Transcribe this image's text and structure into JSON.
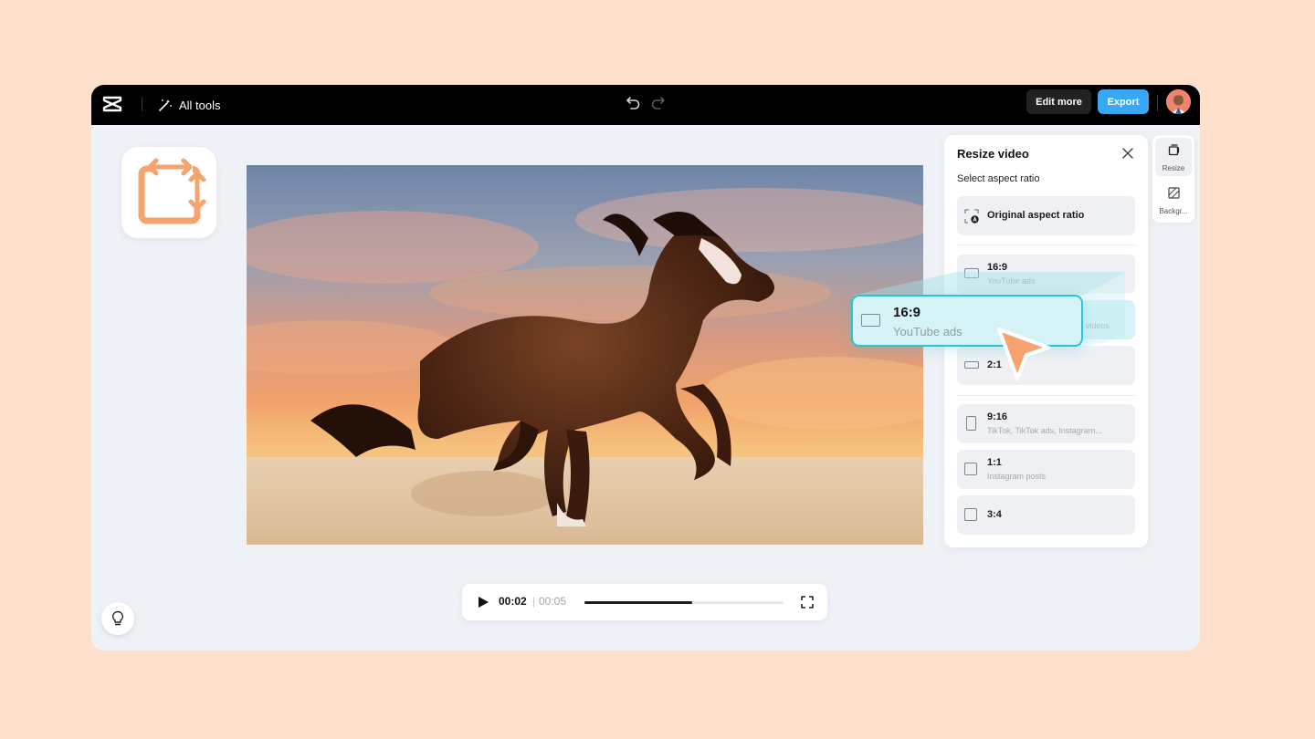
{
  "toolbar": {
    "all_tools_label": "All tools",
    "edit_more_label": "Edit more",
    "export_label": "Export"
  },
  "player": {
    "current_time": "00:02",
    "separator": "|",
    "total_time": "00:05",
    "progress_fraction": 0.54
  },
  "resize_panel": {
    "title": "Resize video",
    "subtitle": "Select aspect ratio",
    "original_label": "Original aspect ratio",
    "options": [
      {
        "label": "16:9",
        "desc": "YouTube ads"
      },
      {
        "label": "",
        "desc": "videos"
      },
      {
        "label": "2:1",
        "desc": ""
      },
      {
        "label": "9:16",
        "desc": "TikTok, TikTok ads, Instagram..."
      },
      {
        "label": "1:1",
        "desc": "Instagram posts"
      },
      {
        "label": "3:4",
        "desc": ""
      }
    ]
  },
  "side_tabs": [
    {
      "label": "Resize"
    },
    {
      "label": "Backgr..."
    }
  ],
  "callout": {
    "label": "16:9",
    "desc": "YouTube ads"
  },
  "colors": {
    "page_background": "#ffe0cc",
    "accent_export": "#3aa7f5",
    "highlight_cyan": "#2cc3d6",
    "brand_orange": "#f6a36f"
  }
}
